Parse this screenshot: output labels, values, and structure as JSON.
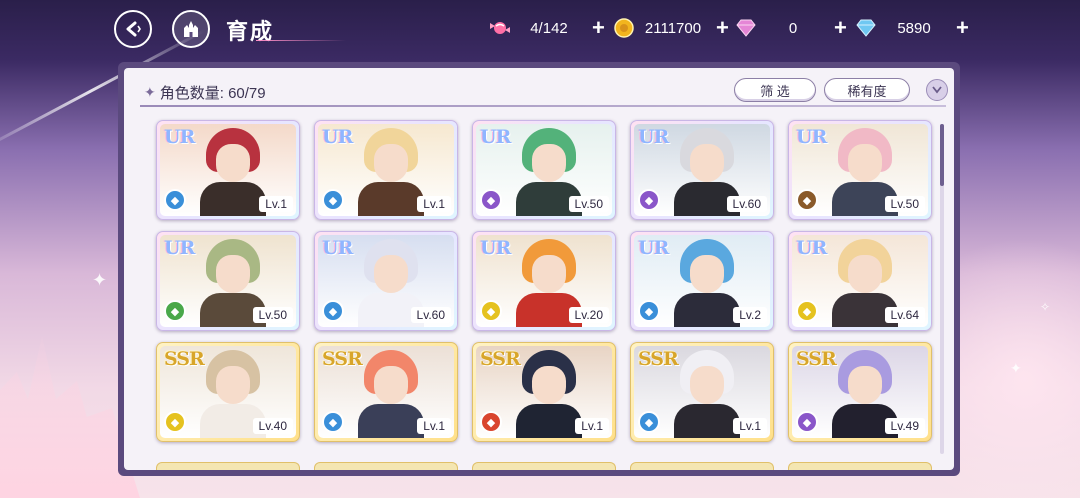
{
  "header": {
    "title": "育成",
    "back_icon": "back-arrow-icon",
    "home_icon": "castle-home-icon"
  },
  "resources": [
    {
      "name": "candy",
      "icon": "candy-icon",
      "value": "4/142",
      "color": "#ff7fb0"
    },
    {
      "name": "coin",
      "icon": "gold-coin-icon",
      "value": "2111700",
      "color": "#f2b51e"
    },
    {
      "name": "pink-gem",
      "icon": "pink-diamond-icon",
      "value": "0",
      "color": "#e586d6"
    },
    {
      "name": "blue-gem",
      "icon": "blue-diamond-icon",
      "value": "5890",
      "color": "#6fc8f2"
    }
  ],
  "panel": {
    "count_label": "角色数量: 60/79",
    "filter_label": "筛 选",
    "rarity_label": "稀有度"
  },
  "cards": [
    {
      "rarity": "UR",
      "level": "Lv.1",
      "attr": "blue",
      "hair": "#b8323f",
      "outfit": "#3a2e2a",
      "bg": "#f4d9c9"
    },
    {
      "rarity": "UR",
      "level": "Lv.1",
      "attr": "blue",
      "hair": "#f1d59a",
      "outfit": "#5a3a2a",
      "bg": "#f6e8d0"
    },
    {
      "rarity": "UR",
      "level": "Lv.50",
      "attr": "purple",
      "hair": "#53b27a",
      "outfit": "#2f3d3a",
      "bg": "#e6f1ee"
    },
    {
      "rarity": "UR",
      "level": "Lv.60",
      "attr": "purple",
      "hair": "#d9d9de",
      "outfit": "#2a2a30",
      "bg": "#cfd8e2"
    },
    {
      "rarity": "UR",
      "level": "Lv.50",
      "attr": "brown",
      "hair": "#f1b9c6",
      "outfit": "#3d4458",
      "bg": "#f0e6d6"
    },
    {
      "rarity": "UR",
      "level": "Lv.50",
      "attr": "green",
      "hair": "#a9b884",
      "outfit": "#5a4a3a",
      "bg": "#efe3cf"
    },
    {
      "rarity": "UR",
      "level": "Lv.60",
      "attr": "blue",
      "hair": "#dfe1ef",
      "outfit": "#f2f2f8",
      "bg": "#d6def0"
    },
    {
      "rarity": "UR",
      "level": "Lv.20",
      "attr": "yellow",
      "hair": "#f19a3a",
      "outfit": "#c8322a",
      "bg": "#efe2cf"
    },
    {
      "rarity": "UR",
      "level": "Lv.2",
      "attr": "blue",
      "hair": "#5aa8df",
      "outfit": "#2c2c3a",
      "bg": "#e0ecf4"
    },
    {
      "rarity": "UR",
      "level": "Lv.64",
      "attr": "yellow",
      "hair": "#f2d39a",
      "outfit": "#3a3338",
      "bg": "#f4e6d8"
    },
    {
      "rarity": "SSR",
      "level": "Lv.40",
      "attr": "yellow",
      "hair": "#d7c2a3",
      "outfit": "#f2ece6",
      "bg": "#efe6da"
    },
    {
      "rarity": "SSR",
      "level": "Lv.1",
      "attr": "blue",
      "hair": "#f2866a",
      "outfit": "#3a3f58",
      "bg": "#ece0d6"
    },
    {
      "rarity": "SSR",
      "level": "Lv.1",
      "attr": "red",
      "hair": "#2a3048",
      "outfit": "#1f2433",
      "bg": "#e8d4c4"
    },
    {
      "rarity": "SSR",
      "level": "Lv.1",
      "attr": "blue",
      "hair": "#f0eff4",
      "outfit": "#2a2830",
      "bg": "#dad8df"
    },
    {
      "rarity": "SSR",
      "level": "Lv.49",
      "attr": "purple",
      "hair": "#a99be0",
      "outfit": "#22202e",
      "bg": "#dcd6e6"
    }
  ],
  "attr_colors": {
    "blue": "#3a8fd9",
    "purple": "#8a56c9",
    "brown": "#8a5a2a",
    "green": "#4aa84a",
    "yellow": "#e5c21f",
    "red": "#d9452e"
  }
}
